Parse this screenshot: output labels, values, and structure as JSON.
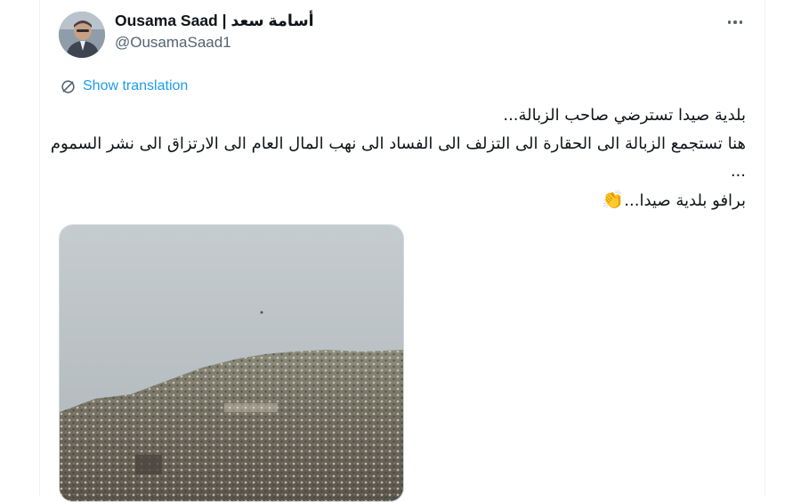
{
  "author": {
    "display_name": "Ousama Saad | أسامة سعد",
    "handle": "@OusamaSaad1",
    "avatar_icon": "user-avatar"
  },
  "actions": {
    "more_icon": "more-horizontal-icon",
    "translate_label": "Show translation",
    "translate_icon": "translate-icon"
  },
  "tweet": {
    "lines": [
      "بلدية صيدا تسترضي صاحب الزبالة...",
      "هنا تستجمع الزبالة الى الحقارة الى التزلف الى الفساد الى نهب المال العام الى الارتزاق الى نشر السموم",
      "...",
      "برافو بلدية صيدا..."
    ],
    "emoji": "👏"
  },
  "colors": {
    "accent": "#1d9bf0",
    "text": "#0f1419",
    "secondary": "#536471",
    "border": "#cfd9de"
  }
}
